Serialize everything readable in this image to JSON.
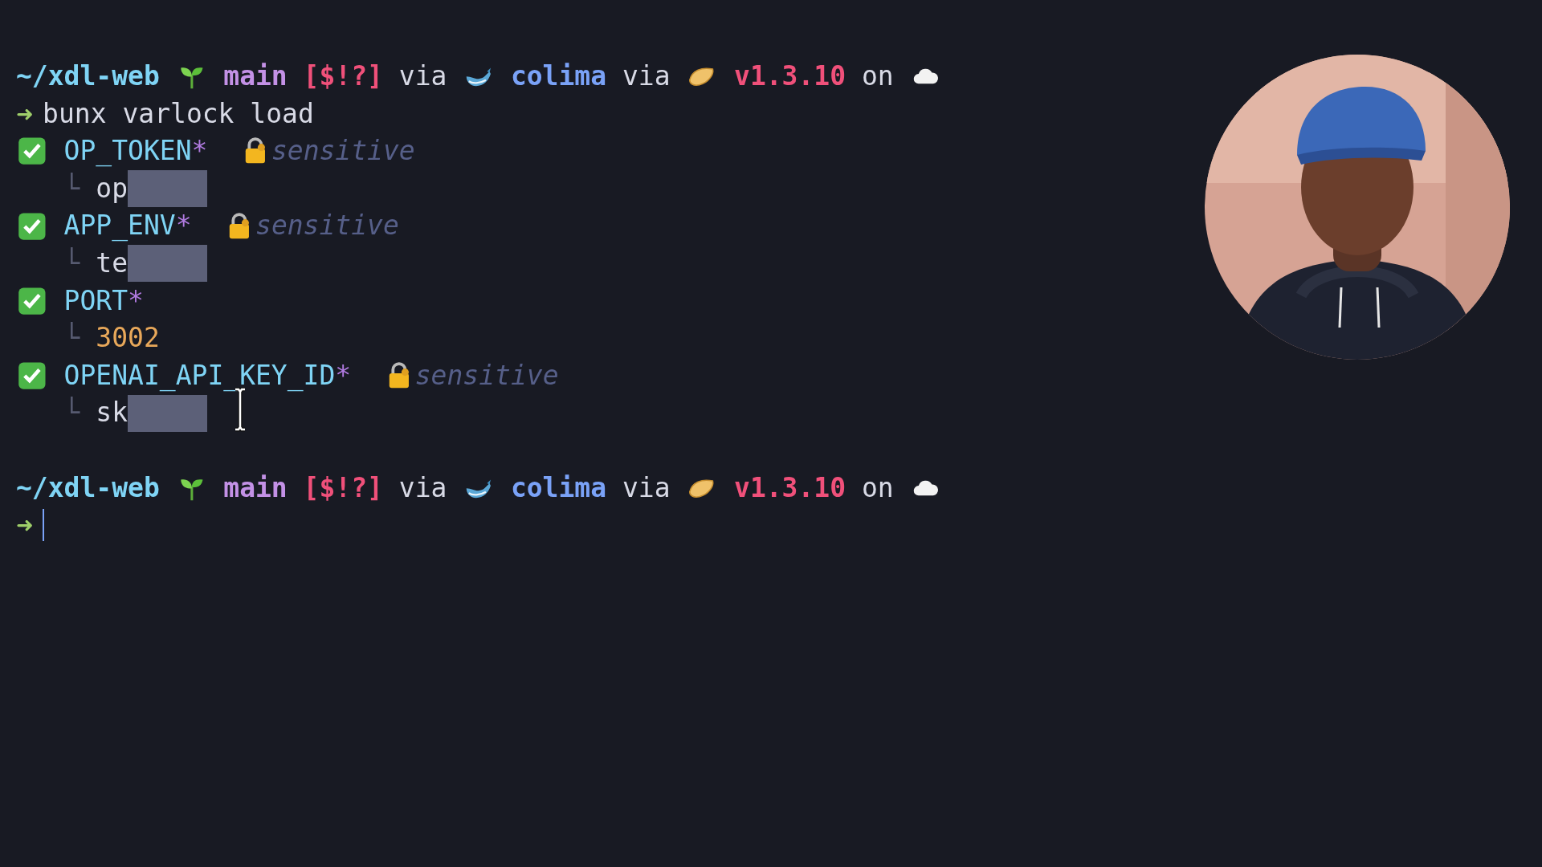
{
  "prompts": [
    {
      "path": "~/xdl-web",
      "branch": "main",
      "git_status": "[$!?]",
      "via_1": "via",
      "context": "colima",
      "via_2": "via",
      "version": "v1.3.10",
      "on": "on",
      "arrow": "➜",
      "command": "bunx varlock load"
    },
    {
      "path": "~/xdl-web",
      "branch": "main",
      "git_status": "[$!?]",
      "via_1": "via",
      "context": "colima",
      "via_2": "via",
      "version": "v1.3.10",
      "on": "on",
      "arrow": "➜"
    }
  ],
  "items": [
    {
      "name": "OP_TOKEN",
      "required_mark": "*",
      "sensitive": true,
      "sensitive_label": "sensitive",
      "tree_mark": "└",
      "value": "op",
      "kind": "text",
      "redacted": true
    },
    {
      "name": "APP_ENV",
      "required_mark": "*",
      "sensitive": true,
      "sensitive_label": "sensitive",
      "tree_mark": "└",
      "value": "te",
      "kind": "text",
      "redacted": true
    },
    {
      "name": "PORT",
      "required_mark": "*",
      "sensitive": false,
      "tree_mark": "└",
      "value": "3002",
      "kind": "number",
      "redacted": false
    },
    {
      "name": "OPENAI_API_KEY_ID",
      "required_mark": "*",
      "sensitive": true,
      "sensitive_label": "sensitive",
      "tree_mark": "└",
      "value": "sk",
      "kind": "text",
      "redacted": true
    }
  ]
}
